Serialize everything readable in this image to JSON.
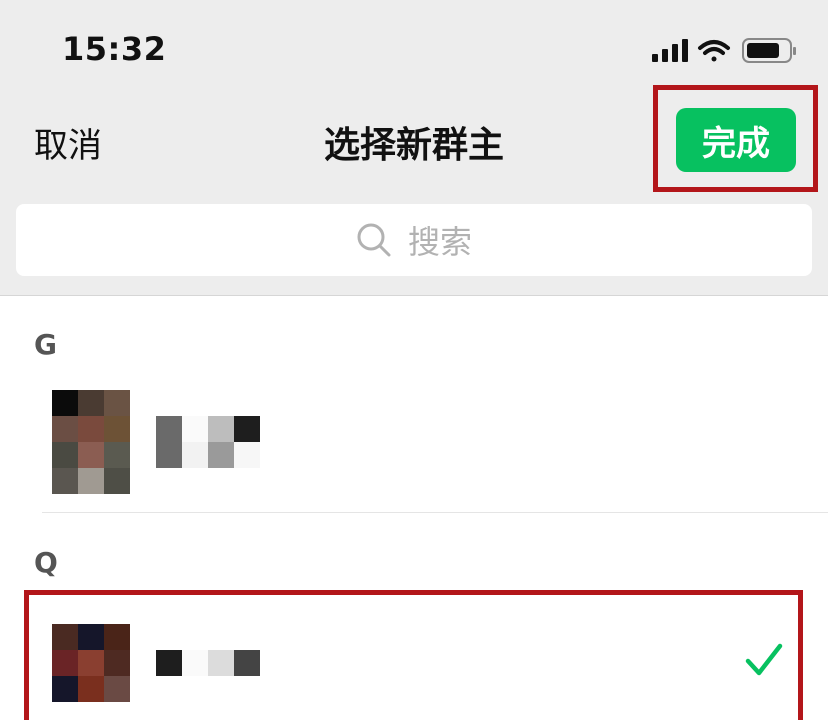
{
  "status_bar": {
    "time": "15:32"
  },
  "nav": {
    "cancel_label": "取消",
    "title": "选择新群主",
    "done_label": "完成"
  },
  "search": {
    "placeholder": "搜索"
  },
  "sections": [
    {
      "letter": "G",
      "contacts": [
        {
          "selected": false
        }
      ]
    },
    {
      "letter": "Q",
      "contacts": [
        {
          "selected": true
        }
      ]
    }
  ],
  "colors": {
    "accent": "#07c160",
    "highlight_frame": "#b3161a",
    "header_bg": "#ededed"
  },
  "icons": {
    "search": "search-icon",
    "check": "check-icon"
  }
}
